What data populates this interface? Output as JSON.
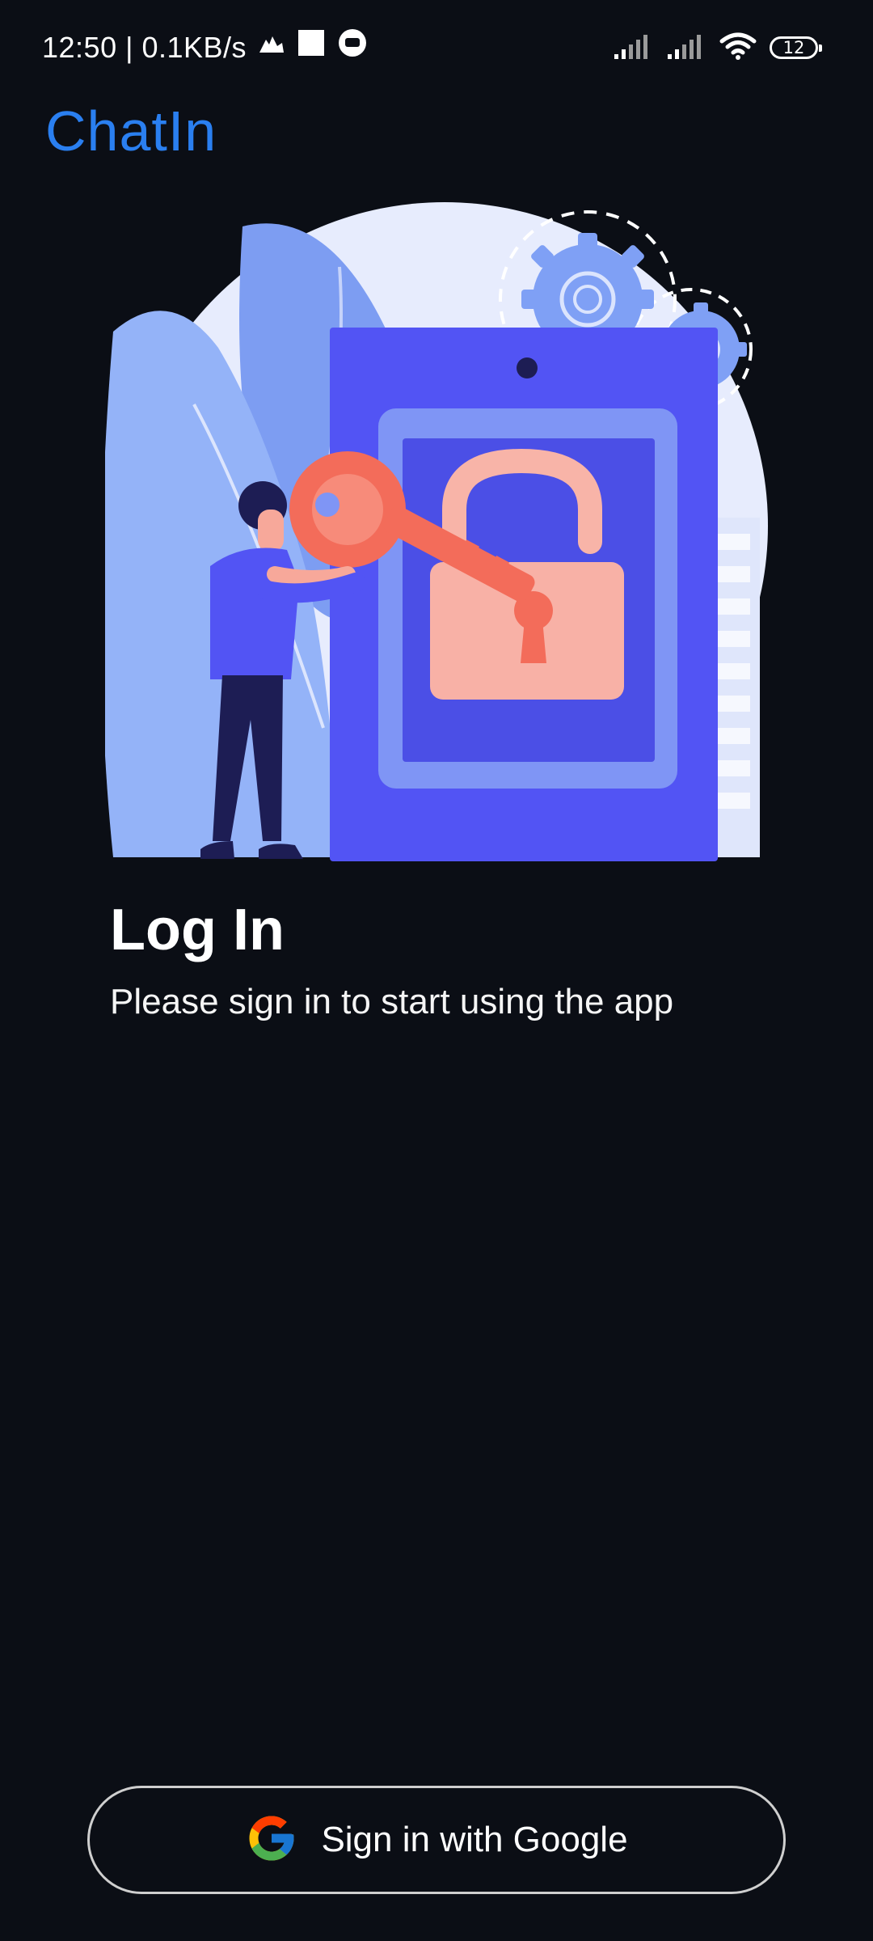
{
  "status_bar": {
    "time_speed": "12:50 | 0.1KB/s",
    "battery": "12"
  },
  "app": {
    "name": "ChatIn"
  },
  "login": {
    "title": "Log In",
    "subtitle": "Please sign in to start using the app"
  },
  "google_button": {
    "label": "Sign in with Google",
    "icon": "google-logo-icon"
  },
  "colors": {
    "background": "#0b0e15",
    "brand": "#2a7ff0",
    "illustration_primary": "#5254f4",
    "illustration_accent": "#f47b6a"
  }
}
